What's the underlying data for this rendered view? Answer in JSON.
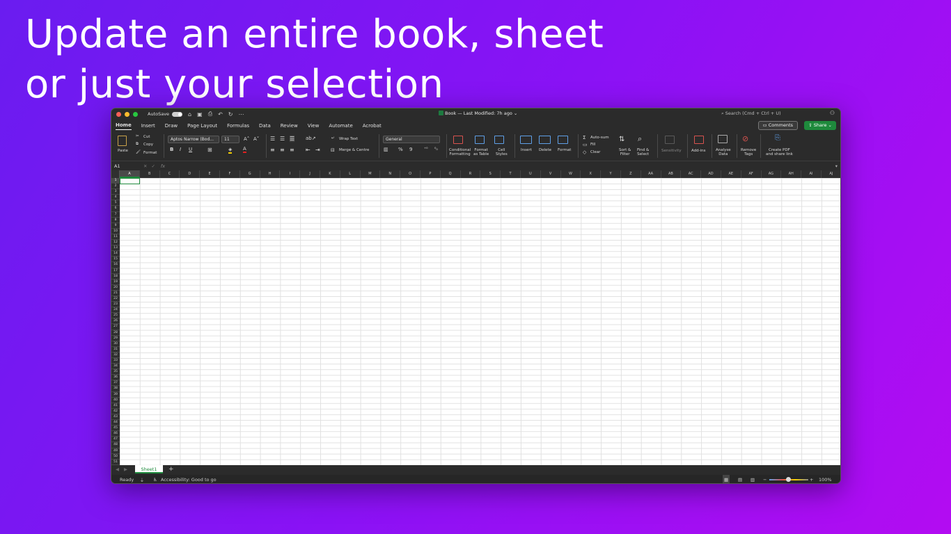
{
  "headline": {
    "line1": "Update an entire book, sheet",
    "line2": "or just your selection"
  },
  "titlebar": {
    "autosave_label": "AutoSave",
    "doc_title": "Book — Last Modified: 7h ago ⌄",
    "search_placeholder": "Search (Cmd + Ctrl + U)",
    "icons": [
      "home-icon",
      "save-icon",
      "print-icon",
      "undo-icon",
      "redo-icon",
      "more-icon"
    ]
  },
  "tabs": [
    "Home",
    "Insert",
    "Draw",
    "Page Layout",
    "Formulas",
    "Data",
    "Review",
    "View",
    "Automate",
    "Acrobat"
  ],
  "active_tab": "Home",
  "buttons": {
    "comments": "Comments",
    "share": "Share"
  },
  "ribbon": {
    "paste": "Paste",
    "cut": "Cut",
    "copy": "Copy",
    "format": "Format",
    "font_name": "Aptos Narrow (Bod...",
    "font_size": "11",
    "bold": "B",
    "italic": "I",
    "underline": "U",
    "wrap_text": "Wrap Text",
    "merge_centre": "Merge & Centre",
    "number_format": "General",
    "percent": "%",
    "comma": "9",
    "conditional_formatting": [
      "Conditional",
      "Formatting"
    ],
    "format_as_table": [
      "Format",
      "as Table"
    ],
    "cell_styles": [
      "Cell",
      "Styles"
    ],
    "insert": "Insert",
    "delete": "Delete",
    "format_cells": "Format",
    "autosum": "Auto-sum",
    "fill": "Fill",
    "clear": "Clear",
    "sort_filter": [
      "Sort &",
      "Filter"
    ],
    "find_select": [
      "Find &",
      "Select"
    ],
    "sensitivity": "Sensitivity",
    "add_ins": "Add-ins",
    "analyse_data": [
      "Analyse",
      "Data"
    ],
    "remove_tags": [
      "Remove",
      "Tags"
    ],
    "create_pdf": [
      "Create PDF",
      "and share link"
    ]
  },
  "formula_bar": {
    "name_box": "A1",
    "fx": "fx"
  },
  "columns": [
    "A",
    "B",
    "C",
    "D",
    "E",
    "F",
    "G",
    "H",
    "I",
    "J",
    "K",
    "L",
    "M",
    "N",
    "O",
    "P",
    "Q",
    "R",
    "S",
    "T",
    "U",
    "V",
    "W",
    "X",
    "Y",
    "Z",
    "AA",
    "AB",
    "AC",
    "AD",
    "AE",
    "AF",
    "AG",
    "AH",
    "AI",
    "AJ"
  ],
  "rows": [
    "1",
    "2",
    "3",
    "4",
    "5",
    "6",
    "7",
    "8",
    "9",
    "10",
    "11",
    "12",
    "13",
    "14",
    "15",
    "16",
    "17",
    "18",
    "19",
    "20",
    "21",
    "22",
    "23",
    "24",
    "25",
    "26",
    "27",
    "28",
    "29",
    "30",
    "31",
    "32",
    "33",
    "34",
    "35",
    "36",
    "37",
    "38",
    "39",
    "40",
    "41",
    "42",
    "43",
    "44",
    "45",
    "46",
    "47",
    "48",
    "49",
    "50",
    "51"
  ],
  "selected_cell": "A1",
  "sheet_tab": "Sheet1",
  "status": {
    "ready": "Ready",
    "accessibility": "Accessibility: Good to go",
    "zoom": "100%"
  },
  "colors": {
    "accent_green": "#1e8a3c",
    "window_bg": "#2b2b2b"
  }
}
